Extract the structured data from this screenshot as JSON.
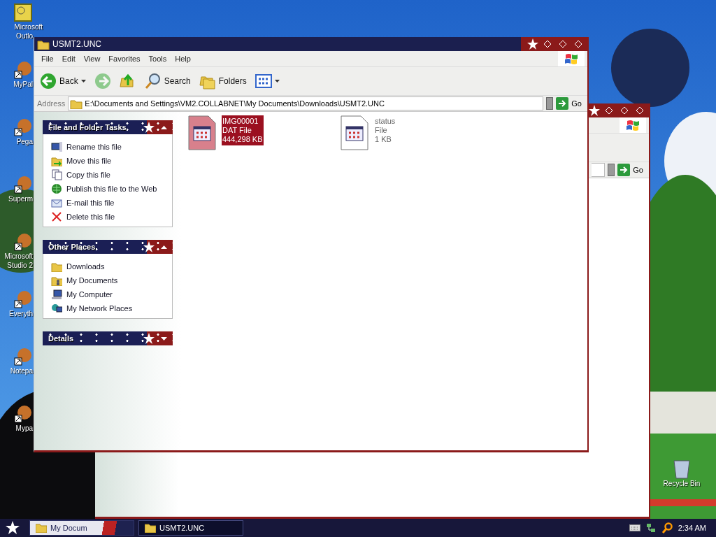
{
  "desktop": {
    "icons": [
      {
        "kind": "app",
        "lines": [
          "Microsoft",
          "Outlo"
        ]
      },
      {
        "kind": "shortcut",
        "lines": [
          "MyPal"
        ]
      },
      {
        "kind": "shortcut",
        "lines": [
          "Pega"
        ]
      },
      {
        "kind": "shortcut",
        "lines": [
          "Superm"
        ]
      },
      {
        "kind": "shortcut",
        "lines": [
          "Microsoft",
          "Studio 2"
        ]
      },
      {
        "kind": "shortcut",
        "lines": [
          "Everyth"
        ]
      },
      {
        "kind": "shortcut",
        "lines": [
          "Notepa"
        ]
      },
      {
        "kind": "shortcut",
        "lines": [
          "Mypa"
        ]
      }
    ],
    "recycle_bin": {
      "label": "Recycle Bin"
    }
  },
  "back_window": {
    "go_button": "Go"
  },
  "window": {
    "title": "USMT2.UNC",
    "menu": [
      "File",
      "Edit",
      "View",
      "Favorites",
      "Tools",
      "Help"
    ],
    "toolbar": [
      {
        "kind": "back",
        "label": "Back",
        "disabled": false
      },
      {
        "kind": "forward",
        "disabled": true
      },
      {
        "kind": "up",
        "disabled": false
      },
      {
        "kind": "search",
        "label": "Search",
        "disabled": false
      },
      {
        "kind": "folders",
        "label": "Folders",
        "disabled": false
      },
      {
        "kind": "views",
        "disabled": false
      }
    ],
    "address": {
      "label": "Address",
      "value": "E:\\Documents and Settings\\VM2.COLLABNET\\My Documents\\Downloads\\USMT2.UNC",
      "go_button": "Go"
    },
    "panels": [
      {
        "title": "File and Folder Tasks",
        "expanded": true,
        "items": [
          {
            "kind": "rename",
            "label": "Rename this file"
          },
          {
            "kind": "move",
            "label": "Move this file"
          },
          {
            "kind": "copy",
            "label": "Copy this file"
          },
          {
            "kind": "publish",
            "label": "Publish this file to the Web"
          },
          {
            "kind": "email",
            "label": "E-mail this file"
          },
          {
            "kind": "delete",
            "label": "Delete this file"
          }
        ]
      },
      {
        "title": "Other Places",
        "expanded": true,
        "items": [
          {
            "kind": "folder",
            "label": "Downloads"
          },
          {
            "kind": "documents",
            "label": "My Documents"
          },
          {
            "kind": "computer",
            "label": "My Computer"
          },
          {
            "kind": "network",
            "label": "My Network Places"
          }
        ]
      },
      {
        "title": "Details",
        "expanded": false
      }
    ],
    "files": [
      {
        "name": "IMG00001",
        "type": "DAT File",
        "size": "444,298 KB",
        "selected": true
      },
      {
        "name": "status",
        "type": "File",
        "size": "1 KB",
        "selected": false
      }
    ]
  },
  "taskbar": {
    "buttons": [
      {
        "label": "My Docum",
        "selected": false
      },
      {
        "label": "USMT2.UNC",
        "selected": true
      }
    ],
    "clock": "2:34 AM"
  }
}
